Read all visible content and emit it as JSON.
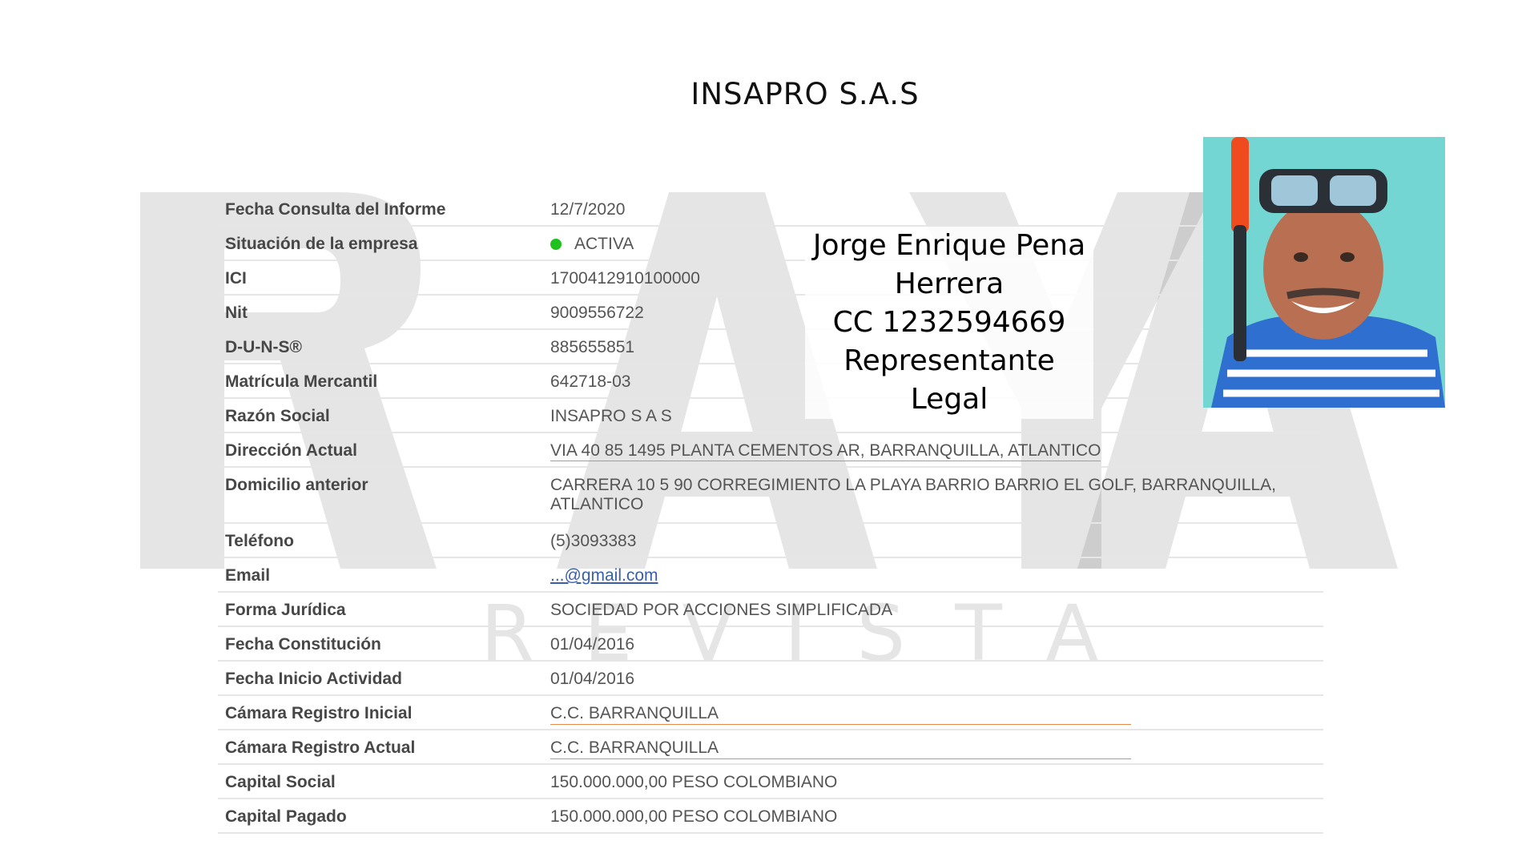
{
  "title": "INSAPRO S.A.S",
  "watermark": {
    "brand": "RAYA",
    "sub": "REVISTA"
  },
  "representative": {
    "name_line1": "Jorge Enrique Pena",
    "name_line2": "Herrera",
    "id_line": "CC 1232594669",
    "role": "Representante Legal"
  },
  "rows": [
    {
      "label": "Fecha Consulta del Informe",
      "value": "12/7/2020"
    },
    {
      "label": "Situación de la empresa",
      "value": "ACTIVA"
    },
    {
      "label": "ICI",
      "value": "1700412910100000"
    },
    {
      "label": "Nit",
      "value": "9009556722"
    },
    {
      "label": "D-U-N-S®",
      "value": "885655851"
    },
    {
      "label": "Matrícula Mercantil",
      "value": "642718-03"
    },
    {
      "label": "Razón Social",
      "value": "INSAPRO S A S"
    },
    {
      "label": "Dirección Actual",
      "value": "VIA 40 85 1495 PLANTA CEMENTOS AR, BARRANQUILLA, ATLANTICO"
    },
    {
      "label": "Domicilio anterior",
      "value": "CARRERA 10 5 90 CORREGIMIENTO LA PLAYA BARRIO BARRIO EL GOLF, BARRANQUILLA, ATLANTICO"
    },
    {
      "label": "Teléfono",
      "value": "(5)3093383"
    },
    {
      "label": "Email",
      "value": "...@gmail.com"
    },
    {
      "label": "Forma Jurídica",
      "value": "SOCIEDAD POR ACCIONES SIMPLIFICADA"
    },
    {
      "label": "Fecha Constitución",
      "value": "01/04/2016"
    },
    {
      "label": "Fecha Inicio Actividad",
      "value": "01/04/2016"
    },
    {
      "label": "Cámara Registro Inicial",
      "value": "C.C. BARRANQUILLA"
    },
    {
      "label": "Cámara Registro Actual",
      "value": "C.C. BARRANQUILLA"
    },
    {
      "label": "Capital Social",
      "value": "150.000.000,00 PESO COLOMBIANO"
    },
    {
      "label": "Capital Pagado",
      "value": "150.000.000,00 PESO COLOMBIANO"
    }
  ],
  "colors": {
    "status_active": "#1fc11f",
    "link": "#3a5fa8",
    "underline_accent": "#e8884a"
  }
}
